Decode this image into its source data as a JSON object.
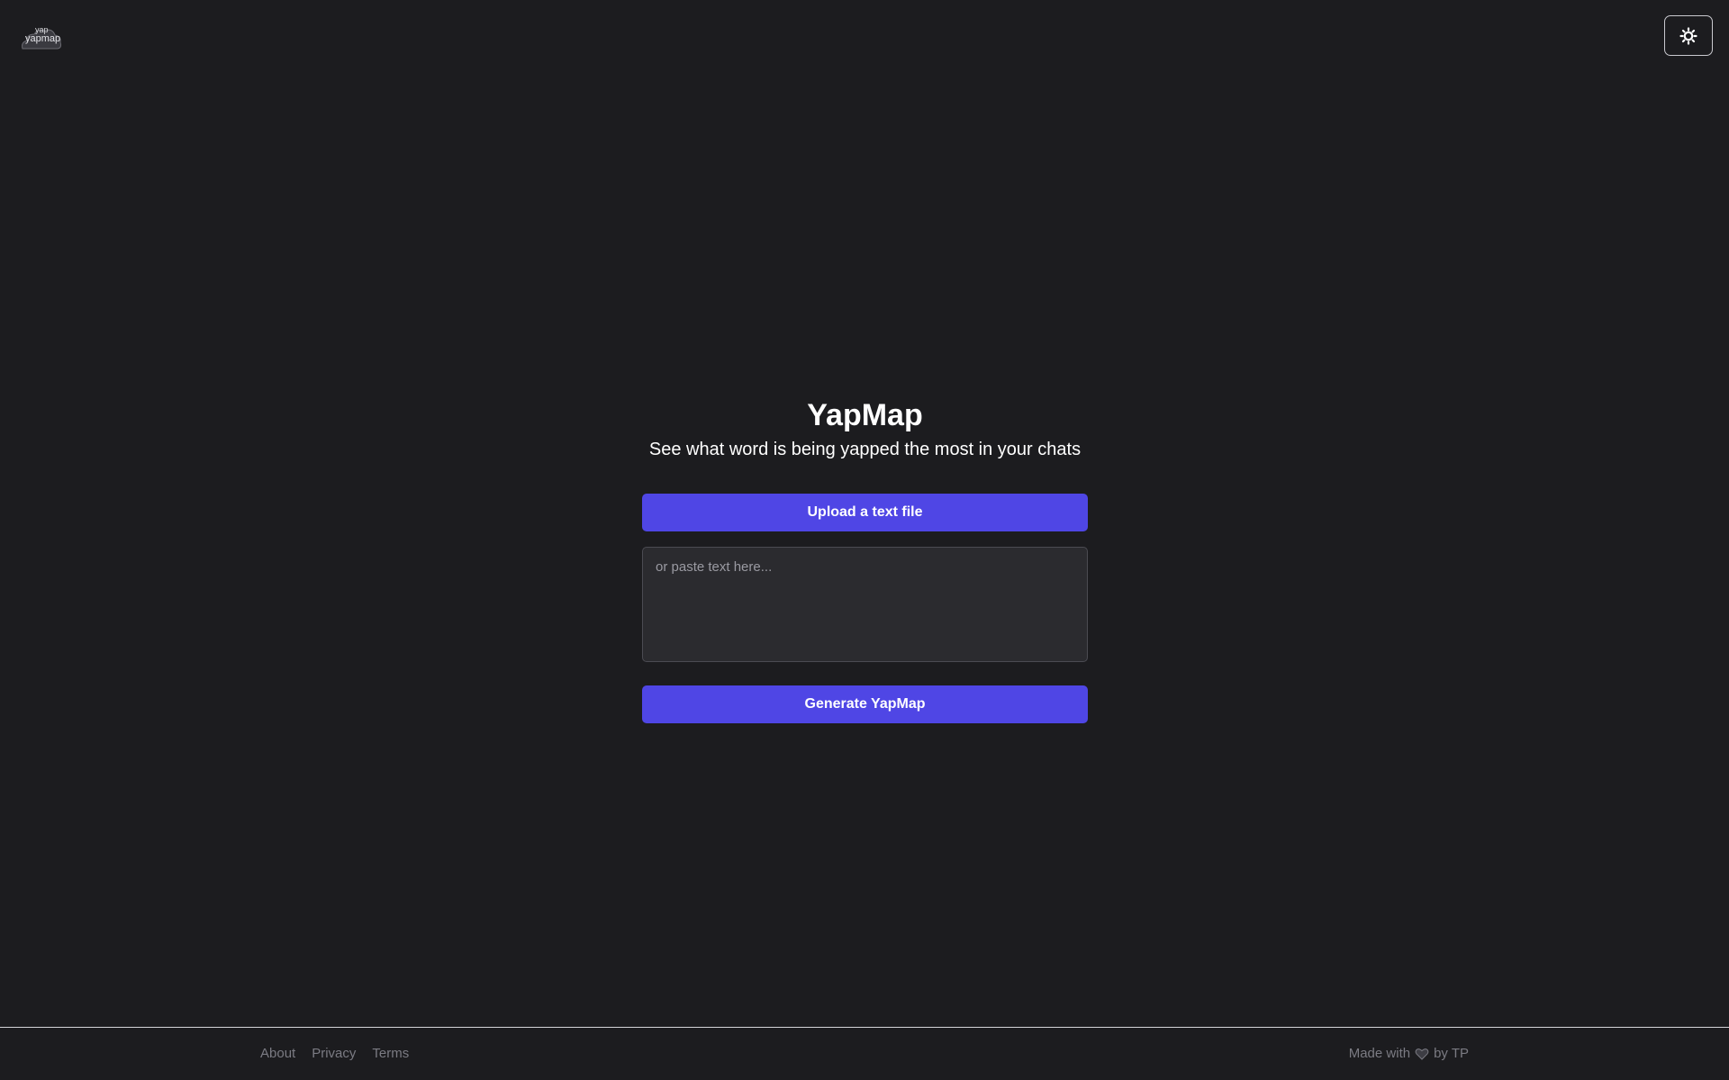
{
  "header": {
    "logo": {
      "line1": "yap",
      "line2": "yapmap"
    },
    "theme_toggle_icon": "sun-icon"
  },
  "main": {
    "title": "YapMap",
    "subtitle": "See what word is being yapped the most in your chats",
    "upload_label": "Upload a text file",
    "paste_placeholder": "or paste text here...",
    "paste_value": "",
    "generate_label": "Generate YapMap"
  },
  "footer": {
    "links": [
      "About",
      "Privacy",
      "Terms"
    ],
    "made_with_prefix": "Made with",
    "made_with_icon": "heart-icon",
    "made_with_suffix": "by TP"
  },
  "colors": {
    "background": "#1c1c1f",
    "accent": "#4f46e5",
    "input_background": "#2b2b2f",
    "footer_text": "#7b7b83"
  }
}
